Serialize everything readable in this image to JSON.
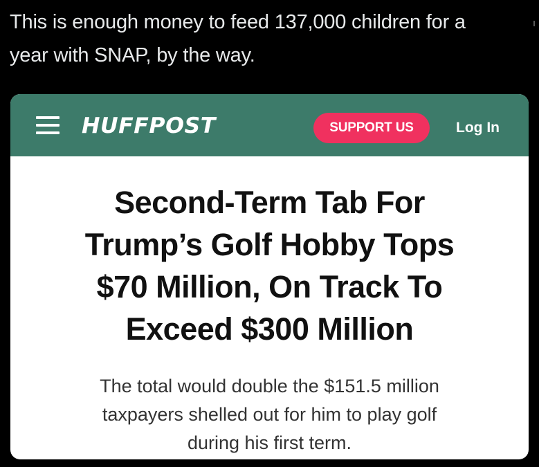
{
  "tweet": {
    "text_lines": [
      "This is enough money to feed 137,000 children for a",
      "year with SNAP, by the way."
    ]
  },
  "article_card": {
    "header": {
      "menu_icon": "hamburger-menu-icon",
      "logo_text": "HUFFPOST",
      "support_label": "SUPPORT US",
      "login_label": "Log In"
    },
    "headline_lines": [
      "Second-Term Tab For",
      "Trump’s Golf Hobby Tops",
      "$70 Million, On Track To",
      "Exceed $300 Million"
    ],
    "subhead_lines": [
      "The total would double the $151.5 million",
      "taxpayers shelled out for him to play golf",
      "during his first term."
    ]
  },
  "colors": {
    "page_background": "#000000",
    "tweet_text": "#e7e9ea",
    "header_green": "#3d7b6a",
    "support_button": "#f0315f",
    "headline_text": "#111111",
    "subhead_text": "#333333"
  }
}
